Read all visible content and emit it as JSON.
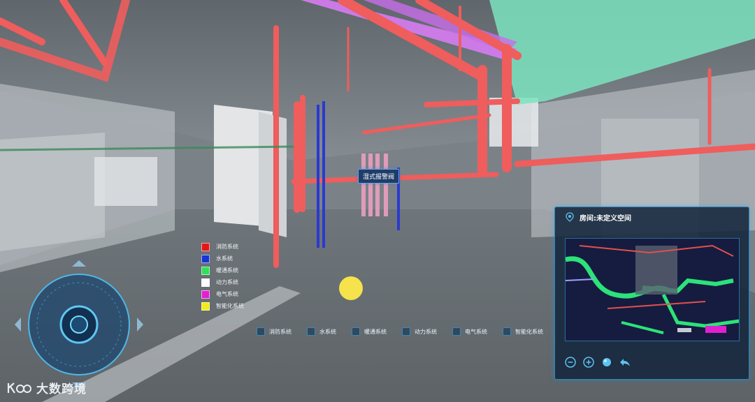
{
  "legend": {
    "items": [
      {
        "label": "消防系统",
        "color": "#e6151a"
      },
      {
        "label": "水系统",
        "color": "#1833d6"
      },
      {
        "label": "暖通系统",
        "color": "#2ee05a"
      },
      {
        "label": "动力系统",
        "color": "#ffffff"
      },
      {
        "label": "电气系统",
        "color": "#e21fd0"
      },
      {
        "label": "智能化系统",
        "color": "#f2ea1a"
      }
    ]
  },
  "valve_tag": "湿式报警阀",
  "filters": [
    {
      "label": "消防系统"
    },
    {
      "label": "水系统"
    },
    {
      "label": "暖通系统"
    },
    {
      "label": "动力系统"
    },
    {
      "label": "电气系统"
    },
    {
      "label": "智能化系统"
    }
  ],
  "room_panel": {
    "title": "房间:未定义空间",
    "icons": [
      "location-pin-icon",
      "zoom-out-icon",
      "zoom-in-icon",
      "globe-icon",
      "back-arrow-icon"
    ]
  },
  "watermark": {
    "text": "大数跨境"
  },
  "colors": {
    "accent": "#2d85b8",
    "fire": "#e84c4c",
    "water": "#2a3ad0",
    "power": "#e7e9ea"
  }
}
